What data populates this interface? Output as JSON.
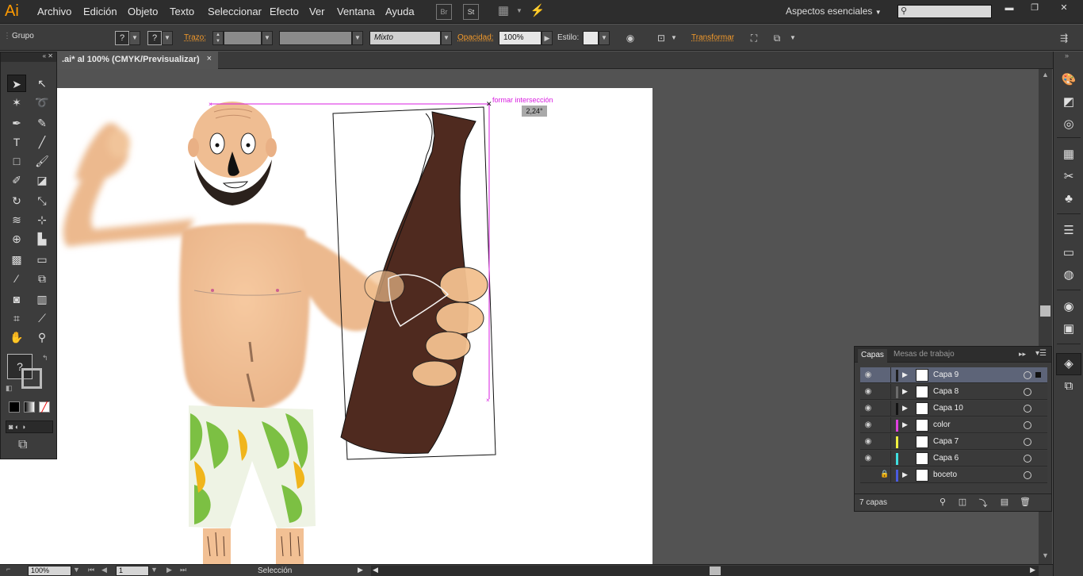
{
  "app": {
    "logo": "Ai"
  },
  "menu": [
    "Archivo",
    "Edición",
    "Objeto",
    "Texto",
    "Seleccionar",
    "Efecto",
    "Ver",
    "Ventana",
    "Ayuda"
  ],
  "bridge_buttons": [
    "Br",
    "St"
  ],
  "workspace": {
    "label": "Aspectos esenciales",
    "search_placeholder": ""
  },
  "control_bar": {
    "selection_type": "Grupo",
    "fill_symbol": "?",
    "stroke_symbol": "?",
    "trazo_label": "Trazo:",
    "stroke_profile_value": "",
    "blend_mode": "Mixto",
    "opacidad_label": "Opacidad:",
    "opacity_value": "100%",
    "estilo_label": "Estilo:",
    "transformar_label": "Transformar"
  },
  "document_tab": {
    "title": ".ai* al 100% (CMYK/Previsualizar)",
    "close": "×"
  },
  "canvas": {
    "smart_guide_label": "formar intersección",
    "angle_readout": "2,24°"
  },
  "toolbox": {
    "fill_stroke_symbol": "?"
  },
  "layers_panel": {
    "tabs": [
      "Capas",
      "Mesas de trabajo"
    ],
    "layers": [
      {
        "name": "Capa 9",
        "color": "#1e1e1e",
        "visible": true,
        "locked": false,
        "expandable": true,
        "selected": true
      },
      {
        "name": "Capa 8",
        "color": "#6b6b6b",
        "visible": true,
        "locked": false,
        "expandable": true,
        "selected": false
      },
      {
        "name": "Capa 10",
        "color": "#141414",
        "visible": true,
        "locked": false,
        "expandable": true,
        "selected": false
      },
      {
        "name": "color",
        "color": "#e040e0",
        "visible": true,
        "locked": false,
        "expandable": true,
        "selected": false
      },
      {
        "name": "Capa 7",
        "color": "#f0f040",
        "visible": true,
        "locked": false,
        "expandable": false,
        "selected": false
      },
      {
        "name": "Capa 6",
        "color": "#40e0e0",
        "visible": true,
        "locked": false,
        "expandable": false,
        "selected": false
      },
      {
        "name": "boceto",
        "color": "#4a5be0",
        "visible": false,
        "locked": true,
        "expandable": true,
        "selected": false
      }
    ],
    "count_label": "7 capas"
  },
  "status_bar": {
    "zoom": "100%",
    "artboard_number": "1",
    "tool_status": "Selección"
  }
}
